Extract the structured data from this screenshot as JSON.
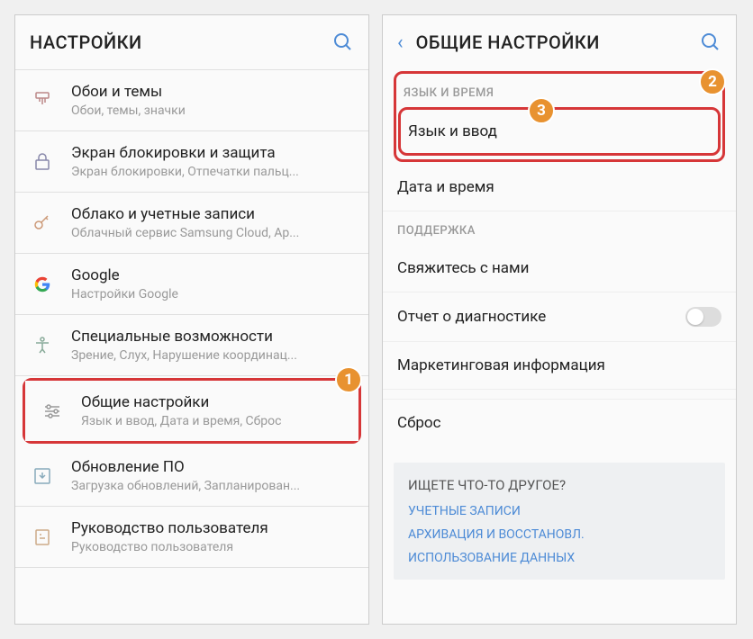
{
  "screen1": {
    "title": "НАСТРОЙКИ",
    "items": [
      {
        "title": "Обои и темы",
        "subtitle": "Обои, темы, значки"
      },
      {
        "title": "Экран блокировки и защита",
        "subtitle": "Экран блокировки, Отпечатки пальц..."
      },
      {
        "title": "Облако и учетные записи",
        "subtitle": "Облачный сервис Samsung Cloud, Ap..."
      },
      {
        "title": "Google",
        "subtitle": "Настройки Google"
      },
      {
        "title": "Специальные возможности",
        "subtitle": "Зрение, Слух, Нарушение координац..."
      },
      {
        "title": "Общие настройки",
        "subtitle": "Язык и ввод, Дата и время, Сброс"
      },
      {
        "title": "Обновление ПО",
        "subtitle": "Загрузка обновлений, Запланирован..."
      },
      {
        "title": "Руководство пользователя",
        "subtitle": "Руководство пользователя"
      }
    ],
    "badge1": "1"
  },
  "screen2": {
    "title": "ОБЩИЕ НАСТРОЙКИ",
    "section1": "ЯЗЫК И ВРЕМЯ",
    "item_lang": "Язык и ввод",
    "item_date": "Дата и время",
    "section2": "ПОДДЕРЖКА",
    "item_contact": "Свяжитесь с нами",
    "item_diag": "Отчет о диагностике",
    "item_marketing": "Маркетинговая информация",
    "item_reset": "Сброс",
    "footer_title": "ИЩЕТЕ ЧТО-ТО ДРУГОЕ?",
    "footer_links": [
      "УЧЕТНЫЕ ЗАПИСИ",
      "АРХИВАЦИЯ И ВОССТАНОВЛ.",
      "ИСПОЛЬЗОВАНИЕ ДАННЫХ"
    ],
    "badge2": "2",
    "badge3": "3"
  }
}
